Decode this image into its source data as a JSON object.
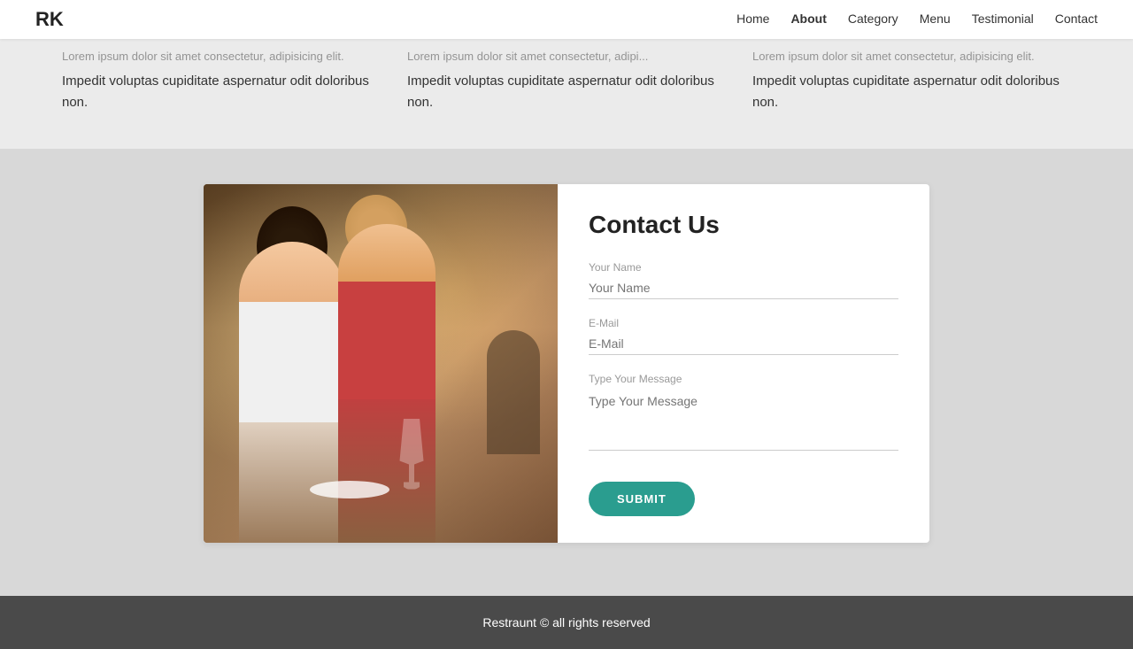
{
  "nav": {
    "logo": "RK",
    "links": [
      {
        "label": "Home",
        "active": false
      },
      {
        "label": "About",
        "active": true
      },
      {
        "label": "Category",
        "active": false
      },
      {
        "label": "Menu",
        "active": false
      },
      {
        "label": "Testimonial",
        "active": false
      },
      {
        "label": "Contact",
        "active": false
      }
    ]
  },
  "cards": [
    {
      "faded": "Lorem ipsum dolor sit amet consectetur, adipisicing elit.",
      "text": "Impedit voluptas cupiditate aspernatur odit doloribus non."
    },
    {
      "faded": "Lorem ipsum dolor sit amet consectetur, adipi...",
      "text": "Impedit voluptas cupiditate aspernatur odit doloribus non."
    },
    {
      "faded": "Lorem ipsum dolor sit amet consectetur, adipisicing elit.",
      "text": "Impedit voluptas cupiditate aspernatur odit doloribus non."
    }
  ],
  "contact": {
    "title": "Contact Us",
    "fields": {
      "name_label": "Your Name",
      "email_label": "E-Mail",
      "message_label": "Type Your Message"
    },
    "submit_label": "SUBMIT"
  },
  "footer": {
    "text": "Restraunt © all rights reserved"
  }
}
